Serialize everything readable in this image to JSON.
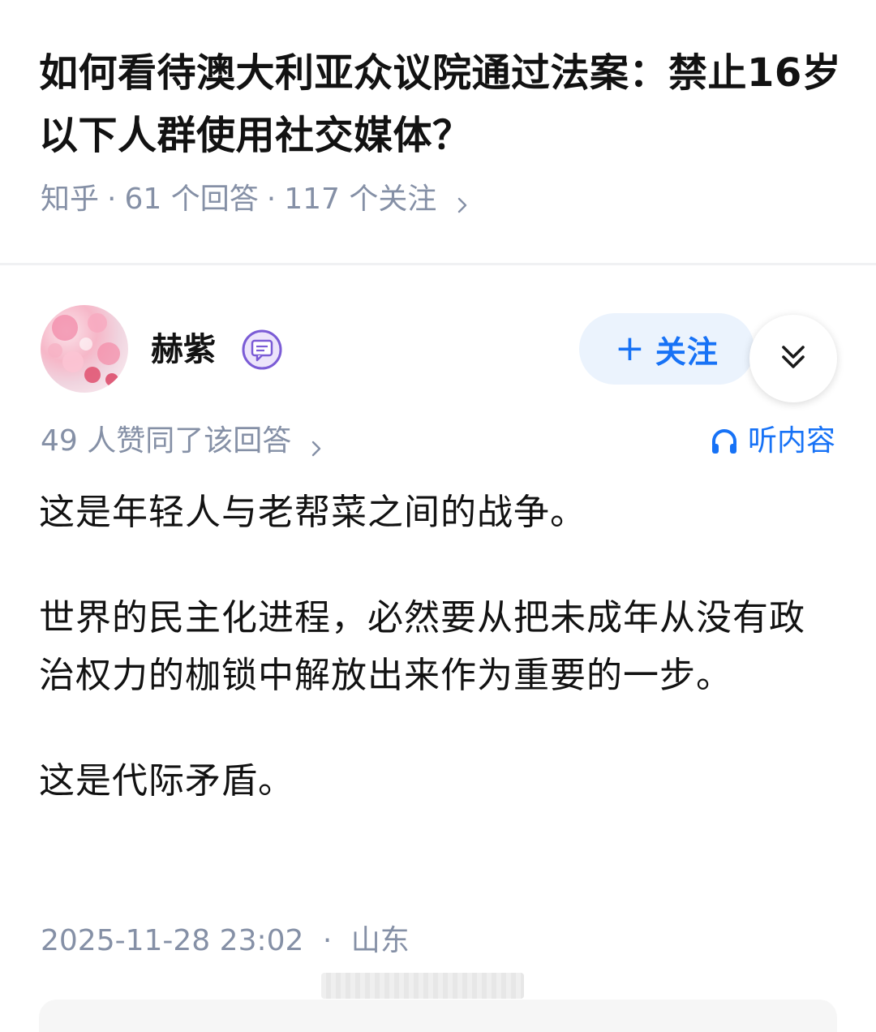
{
  "question": {
    "title": "如何看待澳大利亚众议院通过法案：禁止16岁以下人群使用社交媒体？",
    "source": "知乎",
    "answers": "61 个回答",
    "followers": "117 个关注",
    "separator": "·"
  },
  "author": {
    "name": "赫紫",
    "avatar_icon": "avatar-image",
    "badge_icon": "message-badge-icon",
    "follow_plus": "+",
    "follow_label": "关注",
    "expand_icon": "double-chevron-down-icon"
  },
  "answer_meta": {
    "votes": "49 人赞同了该回答",
    "listen_label": "听内容",
    "listen_icon": "headphones-icon"
  },
  "answer": {
    "paragraphs": [
      "这是年轻人与老帮菜之间的战争。",
      "世界的民主化进程，必然要从把未成年从没有政治权力的枷锁中解放出来作为重要的一步。",
      "这是代际矛盾。"
    ]
  },
  "footer": {
    "datetime": "2025-11-28 23:02",
    "separator": "·",
    "location": "山东"
  },
  "colors": {
    "accent": "#1772f6",
    "follow_bg": "#ebf3fd",
    "meta": "#8590a6",
    "text": "#121212"
  }
}
